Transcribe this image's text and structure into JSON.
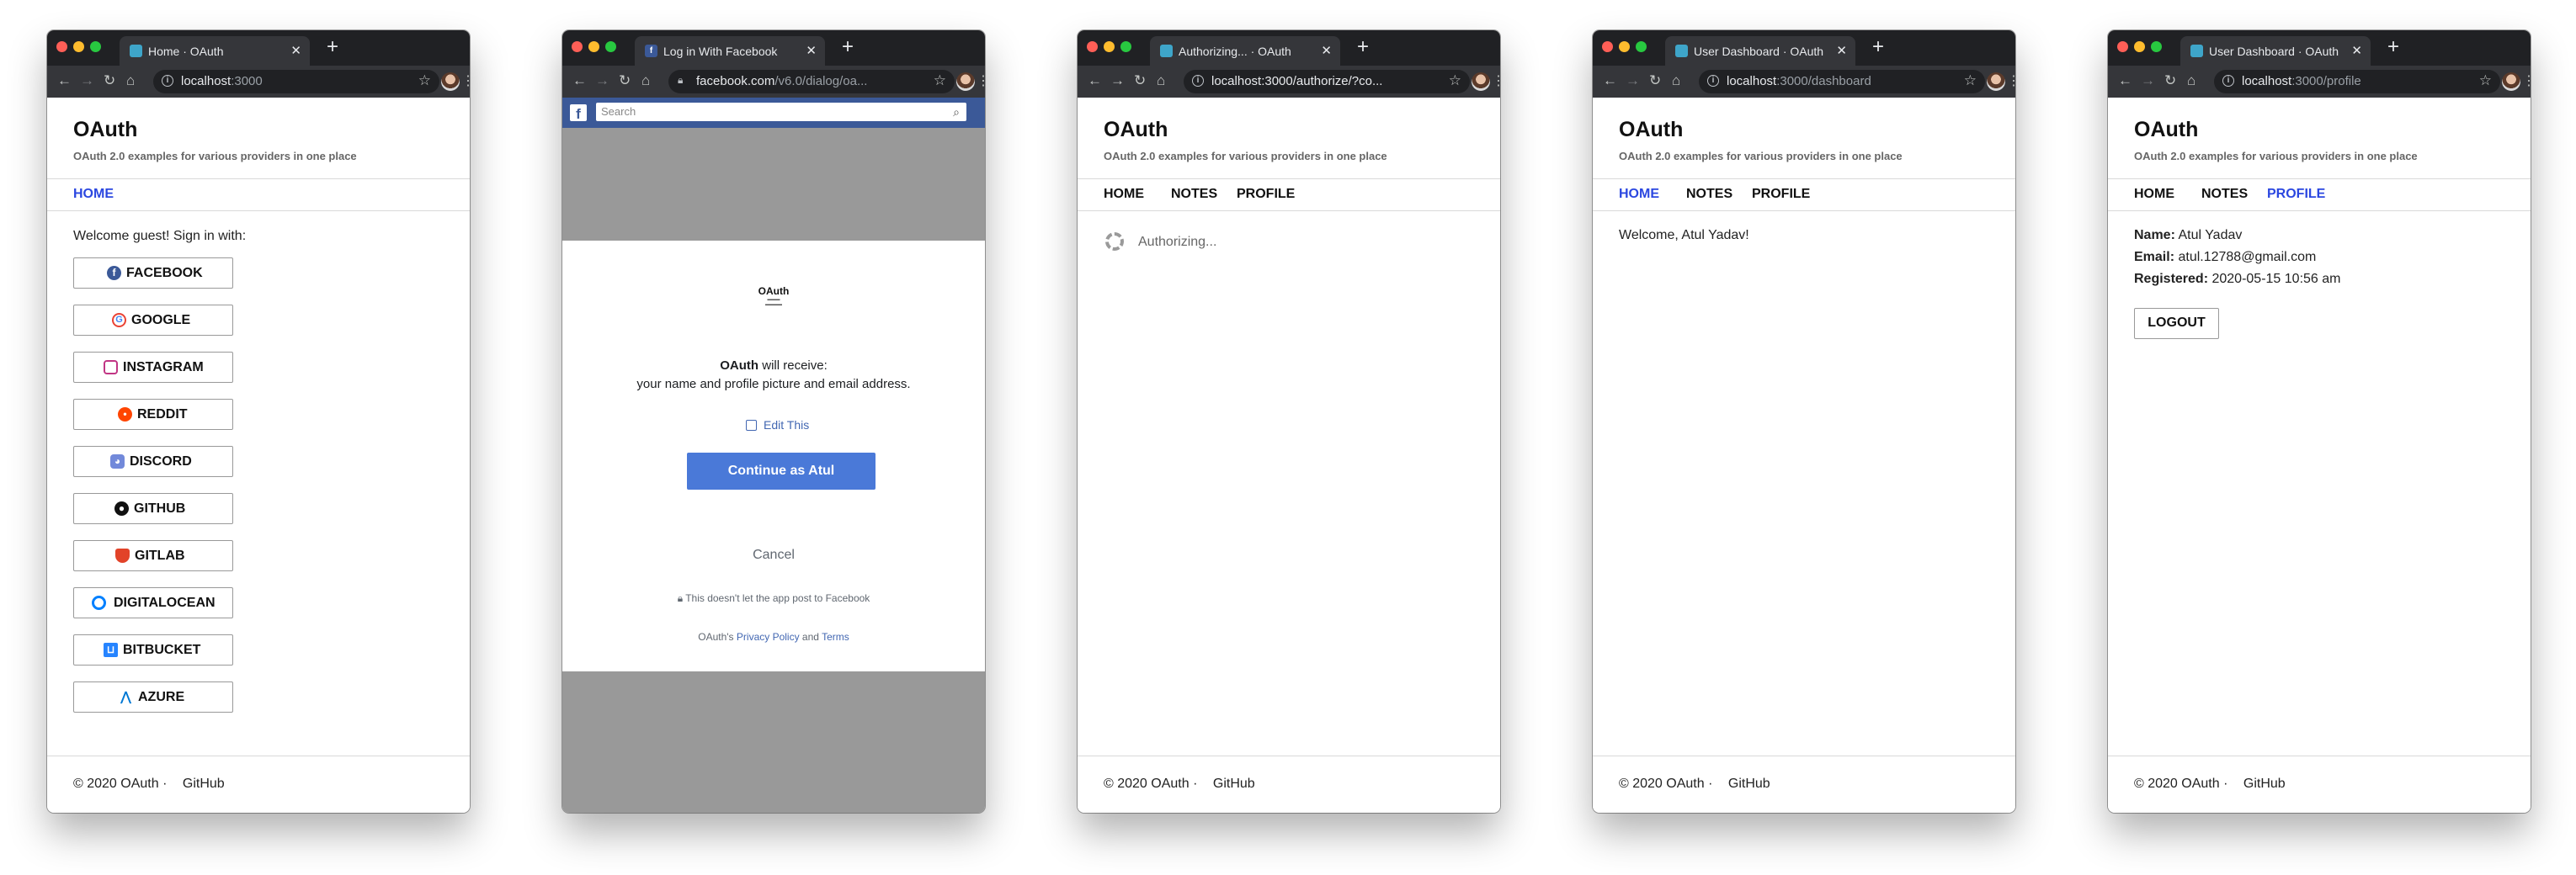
{
  "site": {
    "brand": "OAuth",
    "tagline": "OAuth 2.0 examples for various providers in one place",
    "footer_copyright": "© 2020 OAuth",
    "footer_separator": "·",
    "footer_link": "GitHub",
    "nav": {
      "home": "HOME",
      "notes": "NOTES",
      "profile": "PROFILE"
    }
  },
  "browser": {
    "new_tab": "+",
    "close": "✕"
  },
  "windows": [
    {
      "tab_title": "Home · OAuth",
      "url_host": "localhost",
      "url_rest": ":3000",
      "welcome": "Welcome guest! Sign in with:",
      "providers": [
        {
          "label": "FACEBOOK",
          "icon": "facebook-icon",
          "color": "#3b5998"
        },
        {
          "label": "GOOGLE",
          "icon": "google-icon",
          "color": "#4285f4"
        },
        {
          "label": "INSTAGRAM",
          "icon": "instagram-icon",
          "color": "#c13584"
        },
        {
          "label": "REDDIT",
          "icon": "reddit-icon",
          "color": "#ff4500"
        },
        {
          "label": "DISCORD",
          "icon": "discord-icon",
          "color": "#7289da"
        },
        {
          "label": "GITHUB",
          "icon": "github-icon",
          "color": "#111111"
        },
        {
          "label": "GITLAB",
          "icon": "gitlab-icon",
          "color": "#e24329"
        },
        {
          "label": "DIGITALOCEAN",
          "icon": "digitalocean-icon",
          "color": "#0080ff"
        },
        {
          "label": "BITBUCKET",
          "icon": "bitbucket-icon",
          "color": "#2684ff"
        },
        {
          "label": "AZURE",
          "icon": "azure-icon",
          "color": "#0078d4"
        }
      ]
    },
    {
      "tab_title": "Log in With Facebook",
      "url_host": "facebook.com",
      "url_rest": "/v6.0/dialog/oa...",
      "search_placeholder": "Search",
      "app_logo_text": "OAuth",
      "receive_app": "OAuth",
      "receive_suffix": " will receive:",
      "receive_detail": "your name and profile picture and email address.",
      "edit_label": "Edit This",
      "continue_label": "Continue as Atul",
      "cancel_label": "Cancel",
      "post_note": "This doesn't let the app post to Facebook",
      "policy_prefix": "OAuth's ",
      "policy_link": "Privacy Policy",
      "policy_and": " and ",
      "terms_link": "Terms"
    },
    {
      "tab_title": "Authorizing... · OAuth",
      "url_host": "localhost",
      "url_rest": ":3000/authorize/?co...",
      "status": "Authorizing..."
    },
    {
      "tab_title": "User Dashboard · OAuth",
      "url_host": "localhost",
      "url_rest": ":3000/dashboard",
      "welcome": "Welcome, Atul Yadav!"
    },
    {
      "tab_title": "User Dashboard · OAuth",
      "url_host": "localhost",
      "url_rest": ":3000/profile",
      "name_label": "Name:",
      "name_value": "Atul Yadav",
      "email_label": "Email:",
      "email_value": "atul.12788@gmail.com",
      "registered_label": "Registered:",
      "registered_value": "2020-05-15 10:56 am",
      "logout_label": "LOGOUT"
    }
  ]
}
